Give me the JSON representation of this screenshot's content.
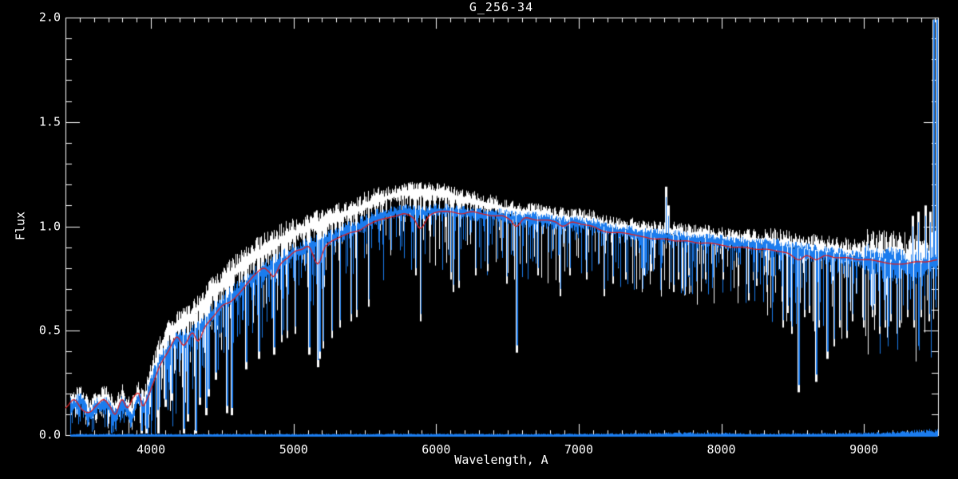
{
  "plot": {
    "title": "G_256-34",
    "xlabel": "Wavelength, A",
    "ylabel": "Flux"
  },
  "colors": {
    "background": "#000000",
    "frame": "#ffffff",
    "observed_blue": "#1b7cee",
    "observed_white": "#ffffff",
    "model_red": "#e01e1e"
  },
  "chart_data": {
    "type": "line",
    "title": "G_256-34",
    "xlabel": "Wavelength, A",
    "ylabel": "Flux",
    "xlim": [
      3400,
      9520
    ],
    "ylim": [
      0.0,
      2.0
    ],
    "grid": false,
    "legend": null,
    "xticks": {
      "major_values": [
        4000,
        5000,
        6000,
        7000,
        8000,
        9000
      ],
      "major_labels": [
        "4000",
        "5000",
        "6000",
        "7000",
        "8000",
        "9000"
      ],
      "minor_step": 100
    },
    "yticks": {
      "major_values": [
        0.0,
        0.5,
        1.0,
        1.5,
        2.0
      ],
      "major_labels": [
        "0.0",
        "0.5",
        "1.0",
        "1.5",
        "2.0"
      ],
      "minor_step": 0.1
    },
    "series": [
      {
        "name": "observed_white",
        "role": "observed spectrum (secondary, drawn behind)",
        "color": "#ffffff",
        "data_start": 3435,
        "offset_from_blue_anchors": [
          [
            3435,
            0.02
          ],
          [
            3950,
            0.02
          ],
          [
            4100,
            0.06
          ],
          [
            4300,
            0.09
          ],
          [
            4500,
            0.1
          ],
          [
            4800,
            0.1
          ],
          [
            5100,
            0.09
          ],
          [
            5400,
            0.08
          ],
          [
            5700,
            0.08
          ],
          [
            5900,
            0.09
          ],
          [
            6100,
            0.07
          ],
          [
            6300,
            0.05
          ],
          [
            6500,
            0.03
          ],
          [
            6800,
            0.02
          ],
          [
            7200,
            0.015
          ],
          [
            7600,
            0.02
          ],
          [
            8000,
            0.015
          ],
          [
            8400,
            0.02
          ],
          [
            8800,
            0.025
          ],
          [
            9200,
            0.03
          ],
          [
            9520,
            0.04
          ]
        ],
        "noise_scale_up": 1.55,
        "noise_scale_down": 1.12
      },
      {
        "name": "observed_blue",
        "role": "observed spectrum (primary)",
        "color": "#1b7cee",
        "data_start": 3435,
        "continuum_anchors": [
          [
            3435,
            0.12
          ],
          [
            3500,
            0.16
          ],
          [
            3560,
            0.09
          ],
          [
            3620,
            0.13
          ],
          [
            3680,
            0.15
          ],
          [
            3740,
            0.08
          ],
          [
            3800,
            0.15
          ],
          [
            3860,
            0.07
          ],
          [
            3905,
            0.17
          ],
          [
            3950,
            0.13
          ],
          [
            4000,
            0.25
          ],
          [
            4060,
            0.35
          ],
          [
            4120,
            0.41
          ],
          [
            4200,
            0.46
          ],
          [
            4260,
            0.46
          ],
          [
            4320,
            0.5
          ],
          [
            4400,
            0.56
          ],
          [
            4500,
            0.62
          ],
          [
            4600,
            0.68
          ],
          [
            4700,
            0.74
          ],
          [
            4800,
            0.78
          ],
          [
            4900,
            0.82
          ],
          [
            5000,
            0.86
          ],
          [
            5100,
            0.9
          ],
          [
            5200,
            0.92
          ],
          [
            5300,
            0.95
          ],
          [
            5400,
            0.98
          ],
          [
            5500,
            1.01
          ],
          [
            5600,
            1.04
          ],
          [
            5700,
            1.06
          ],
          [
            5800,
            1.07
          ],
          [
            5900,
            1.06
          ],
          [
            6000,
            1.07
          ],
          [
            6100,
            1.07
          ],
          [
            6200,
            1.06
          ],
          [
            6300,
            1.05
          ],
          [
            6400,
            1.05
          ],
          [
            6500,
            1.04
          ],
          [
            6600,
            1.03
          ],
          [
            6700,
            1.03
          ],
          [
            6800,
            1.02
          ],
          [
            6900,
            1.01
          ],
          [
            7000,
            1.01
          ],
          [
            7100,
            1.0
          ],
          [
            7200,
            0.98
          ],
          [
            7300,
            0.97
          ],
          [
            7400,
            0.96
          ],
          [
            7500,
            0.95
          ],
          [
            7600,
            0.95
          ],
          [
            7700,
            0.94
          ],
          [
            7800,
            0.93
          ],
          [
            7900,
            0.93
          ],
          [
            8000,
            0.92
          ],
          [
            8100,
            0.91
          ],
          [
            8200,
            0.91
          ],
          [
            8300,
            0.9
          ],
          [
            8400,
            0.89
          ],
          [
            8500,
            0.88
          ],
          [
            8600,
            0.87
          ],
          [
            8700,
            0.86
          ],
          [
            8800,
            0.85
          ],
          [
            8900,
            0.84
          ],
          [
            9000,
            0.83
          ],
          [
            9100,
            0.82
          ],
          [
            9200,
            0.81
          ],
          [
            9300,
            0.8
          ],
          [
            9400,
            0.8
          ],
          [
            9520,
            0.82
          ]
        ],
        "noise_regions": [
          {
            "from": 3435,
            "to": 3960,
            "up": 0.05,
            "p": 0.8,
            "max_down": 0.1
          },
          {
            "from": 3960,
            "to": 4400,
            "up": 0.05,
            "p": 0.7,
            "max_down": 0.38
          },
          {
            "from": 4400,
            "to": 5000,
            "up": 0.06,
            "p": 0.6,
            "max_down": 0.3
          },
          {
            "from": 5000,
            "to": 5600,
            "up": 0.05,
            "p": 0.55,
            "max_down": 0.28
          },
          {
            "from": 5600,
            "to": 6300,
            "up": 0.04,
            "p": 0.5,
            "max_down": 0.3
          },
          {
            "from": 6300,
            "to": 7000,
            "up": 0.04,
            "p": 0.5,
            "max_down": 0.28
          },
          {
            "from": 7000,
            "to": 7550,
            "up": 0.04,
            "p": 0.45,
            "max_down": 0.25
          },
          {
            "from": 7550,
            "to": 8300,
            "up": 0.04,
            "p": 0.5,
            "max_down": 0.28
          },
          {
            "from": 8300,
            "to": 9000,
            "up": 0.05,
            "p": 0.55,
            "max_down": 0.35
          },
          {
            "from": 9000,
            "to": 9520,
            "up": 0.09,
            "p": 0.6,
            "max_down": 0.4
          }
        ]
      },
      {
        "name": "model_red",
        "role": "smooth template / model fit",
        "color": "#e01e1e",
        "anchors": [
          [
            3400,
            0.13
          ],
          [
            3460,
            0.17
          ],
          [
            3520,
            0.12
          ],
          [
            3570,
            0.11
          ],
          [
            3630,
            0.15
          ],
          [
            3670,
            0.17
          ],
          [
            3710,
            0.14
          ],
          [
            3750,
            0.1
          ],
          [
            3795,
            0.17
          ],
          [
            3835,
            0.13
          ],
          [
            3875,
            0.18
          ],
          [
            3915,
            0.2
          ],
          [
            3940,
            0.14
          ],
          [
            3970,
            0.17
          ],
          [
            4010,
            0.24
          ],
          [
            4060,
            0.33
          ],
          [
            4120,
            0.4
          ],
          [
            4180,
            0.47
          ],
          [
            4230,
            0.43
          ],
          [
            4290,
            0.49
          ],
          [
            4330,
            0.45
          ],
          [
            4380,
            0.52
          ],
          [
            4440,
            0.57
          ],
          [
            4500,
            0.62
          ],
          [
            4560,
            0.64
          ],
          [
            4620,
            0.68
          ],
          [
            4680,
            0.73
          ],
          [
            4730,
            0.77
          ],
          [
            4790,
            0.8
          ],
          [
            4830,
            0.78
          ],
          [
            4861,
            0.76
          ],
          [
            4910,
            0.82
          ],
          [
            4960,
            0.85
          ],
          [
            5010,
            0.88
          ],
          [
            5060,
            0.89
          ],
          [
            5110,
            0.9
          ],
          [
            5170,
            0.82
          ],
          [
            5220,
            0.9
          ],
          [
            5270,
            0.93
          ],
          [
            5330,
            0.95
          ],
          [
            5400,
            0.97
          ],
          [
            5460,
            0.98
          ],
          [
            5530,
            1.01
          ],
          [
            5600,
            1.03
          ],
          [
            5660,
            1.04
          ],
          [
            5720,
            1.05
          ],
          [
            5780,
            1.06
          ],
          [
            5840,
            1.04
          ],
          [
            5890,
            0.99
          ],
          [
            5950,
            1.05
          ],
          [
            6020,
            1.07
          ],
          [
            6100,
            1.07
          ],
          [
            6180,
            1.06
          ],
          [
            6250,
            1.07
          ],
          [
            6320,
            1.06
          ],
          [
            6400,
            1.05
          ],
          [
            6470,
            1.05
          ],
          [
            6520,
            1.03
          ],
          [
            6563,
            1.0
          ],
          [
            6620,
            1.04
          ],
          [
            6700,
            1.03
          ],
          [
            6780,
            1.03
          ],
          [
            6840,
            1.02
          ],
          [
            6890,
            1.0
          ],
          [
            6950,
            1.02
          ],
          [
            7020,
            1.01
          ],
          [
            7100,
            1.0
          ],
          [
            7160,
            0.98
          ],
          [
            7220,
            0.97
          ],
          [
            7300,
            0.97
          ],
          [
            7380,
            0.96
          ],
          [
            7450,
            0.95
          ],
          [
            7520,
            0.94
          ],
          [
            7600,
            0.94
          ],
          [
            7680,
            0.93
          ],
          [
            7760,
            0.93
          ],
          [
            7840,
            0.92
          ],
          [
            7920,
            0.92
          ],
          [
            8000,
            0.91
          ],
          [
            8080,
            0.9
          ],
          [
            8160,
            0.9
          ],
          [
            8240,
            0.89
          ],
          [
            8320,
            0.89
          ],
          [
            8400,
            0.88
          ],
          [
            8470,
            0.87
          ],
          [
            8542,
            0.84
          ],
          [
            8600,
            0.86
          ],
          [
            8662,
            0.84
          ],
          [
            8730,
            0.86
          ],
          [
            8800,
            0.85
          ],
          [
            8880,
            0.85
          ],
          [
            8960,
            0.84
          ],
          [
            9040,
            0.84
          ],
          [
            9120,
            0.83
          ],
          [
            9200,
            0.82
          ],
          [
            9280,
            0.82
          ],
          [
            9360,
            0.83
          ],
          [
            9440,
            0.83
          ],
          [
            9520,
            0.84
          ]
        ]
      },
      {
        "name": "noise_floor",
        "role": "error spectrum along zero level",
        "color": "#1b7cee",
        "data_start": 3435,
        "amp_anchors": [
          [
            3435,
            0.006
          ],
          [
            7000,
            0.007
          ],
          [
            7550,
            0.012
          ],
          [
            7700,
            0.015
          ],
          [
            8000,
            0.012
          ],
          [
            8300,
            0.008
          ],
          [
            8600,
            0.01
          ],
          [
            9000,
            0.012
          ],
          [
            9250,
            0.02
          ],
          [
            9400,
            0.03
          ],
          [
            9520,
            0.035
          ]
        ]
      }
    ],
    "absorption_lines": [
      [
        3933,
        0.02
      ],
      [
        3968,
        0.03
      ],
      [
        4046,
        0.12
      ],
      [
        4101,
        0.17
      ],
      [
        4144,
        0.2
      ],
      [
        4227,
        0.03
      ],
      [
        4254,
        0.1
      ],
      [
        4310,
        0.02
      ],
      [
        4340,
        0.18
      ],
      [
        4383,
        0.13
      ],
      [
        4405,
        0.22
      ],
      [
        4455,
        0.3
      ],
      [
        4531,
        0.14
      ],
      [
        4565,
        0.13
      ],
      [
        4668,
        0.35
      ],
      [
        4754,
        0.4
      ],
      [
        4861,
        0.42
      ],
      [
        4920,
        0.48
      ],
      [
        4957,
        0.5
      ],
      [
        5015,
        0.52
      ],
      [
        5110,
        0.42
      ],
      [
        5167,
        0.4
      ],
      [
        5172,
        0.36
      ],
      [
        5183,
        0.4
      ],
      [
        5208,
        0.45
      ],
      [
        5270,
        0.5
      ],
      [
        5328,
        0.55
      ],
      [
        5404,
        0.58
      ],
      [
        5446,
        0.6
      ],
      [
        5530,
        0.65
      ],
      [
        5860,
        0.8
      ],
      [
        5890,
        0.58
      ],
      [
        6102,
        0.78
      ],
      [
        6122,
        0.72
      ],
      [
        6162,
        0.74
      ],
      [
        6280,
        0.8
      ],
      [
        6360,
        0.82
      ],
      [
        6495,
        0.76
      ],
      [
        6563,
        0.43
      ],
      [
        6717,
        0.8
      ],
      [
        6870,
        0.7
      ],
      [
        6940,
        0.8
      ],
      [
        7055,
        0.78
      ],
      [
        7180,
        0.7
      ],
      [
        7240,
        0.76
      ],
      [
        7330,
        0.78
      ],
      [
        7460,
        0.8
      ],
      [
        7510,
        0.82
      ],
      [
        7665,
        0.72
      ],
      [
        7700,
        0.78
      ],
      [
        7775,
        0.8
      ],
      [
        7890,
        0.78
      ],
      [
        8015,
        0.78
      ],
      [
        8195,
        0.68
      ],
      [
        8250,
        0.75
      ],
      [
        8320,
        0.72
      ],
      [
        8434,
        0.55
      ],
      [
        8468,
        0.62
      ],
      [
        8498,
        0.52
      ],
      [
        8542,
        0.24
      ],
      [
        8585,
        0.6
      ],
      [
        8620,
        0.62
      ],
      [
        8662,
        0.29
      ],
      [
        8688,
        0.55
      ],
      [
        8740,
        0.4
      ],
      [
        8790,
        0.46
      ],
      [
        8830,
        0.55
      ],
      [
        8880,
        0.5
      ],
      [
        8920,
        0.58
      ],
      [
        9000,
        0.55
      ],
      [
        9060,
        0.6
      ],
      [
        9110,
        0.52
      ],
      [
        9150,
        0.55
      ],
      [
        9190,
        0.58
      ],
      [
        9250,
        0.55
      ],
      [
        9310,
        0.6
      ],
      [
        9350,
        0.55
      ],
      [
        9405,
        0.6
      ],
      [
        9460,
        0.58
      ]
    ],
    "emission_spikes": [
      [
        7613,
        1.14
      ],
      [
        7628,
        1.05
      ],
      [
        9340,
        1.0
      ],
      [
        9380,
        1.02
      ],
      [
        9430,
        1.05
      ],
      [
        9465,
        1.02
      ],
      [
        9487,
        1.99
      ],
      [
        9508,
        1.99
      ]
    ]
  }
}
